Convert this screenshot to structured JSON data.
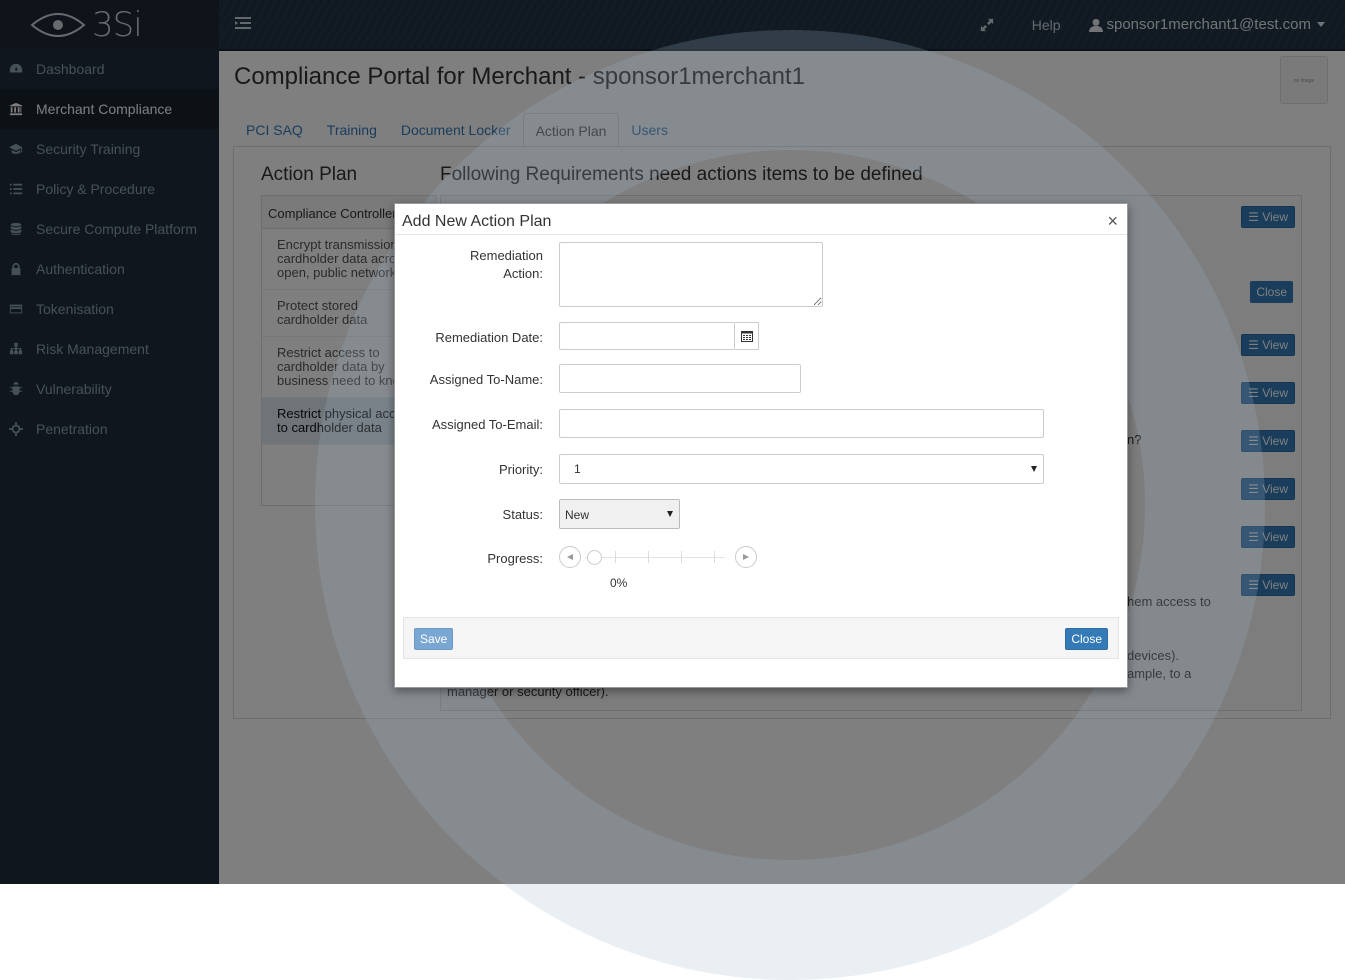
{
  "brand": {
    "logo_text": "3Si"
  },
  "topbar": {
    "help_label": "Help",
    "user_email": "sponsor1merchant1@test.com"
  },
  "sidebar": {
    "items": [
      {
        "label": "Dashboard",
        "icon": "dashboard-icon"
      },
      {
        "label": "Merchant Compliance",
        "icon": "bank-icon"
      },
      {
        "label": "Security Training",
        "icon": "graduation-cap-icon"
      },
      {
        "label": "Policy & Procedure",
        "icon": "list-icon"
      },
      {
        "label": "Secure Compute Platform",
        "icon": "database-icon"
      },
      {
        "label": "Authentication",
        "icon": "lock-icon"
      },
      {
        "label": "Tokenisation",
        "icon": "credit-card-icon"
      },
      {
        "label": "Risk Management",
        "icon": "sitemap-icon"
      },
      {
        "label": "Vulnerability",
        "icon": "bug-icon"
      },
      {
        "label": "Penetration",
        "icon": "crosshairs-icon"
      }
    ]
  },
  "main": {
    "title": "Compliance Portal for Merchant - sponsor1merchant1",
    "thumb_text": "no image",
    "tabs": [
      "PCI SAQ",
      "Training",
      "Document Locker",
      "Action Plan",
      "Users"
    ],
    "action_plan_heading": "Action Plan",
    "requirements_heading": "Following Requirements need actions items to be defined",
    "controls_header": "Compliance Controller",
    "controls": [
      "Encrypt transmission of cardholder data across open, public networks",
      "Protect stored cardholder data",
      "Restrict access to cardholder data by business need to know",
      "Restrict physical access to cardholder data"
    ],
    "view_label": "View",
    "close_label": "Close",
    "req_fragments": [
      "n?",
      "hem access to",
      "devices).",
      "ample, to a",
      "manager or security officer)."
    ]
  },
  "modal": {
    "title": "Add New Action Plan",
    "close_symbol": "×",
    "fields": {
      "remediation_action_label": "Remediation Action:",
      "remediation_date_label": "Remediation Date:",
      "assigned_name_label": "Assigned To-Name:",
      "assigned_email_label": "Assigned To-Email:",
      "priority_label": "Priority:",
      "priority_value": "1",
      "status_label": "Status:",
      "status_value": "New",
      "progress_label": "Progress:",
      "progress_value": "0%"
    },
    "save_label": "Save",
    "close_label": "Close"
  }
}
